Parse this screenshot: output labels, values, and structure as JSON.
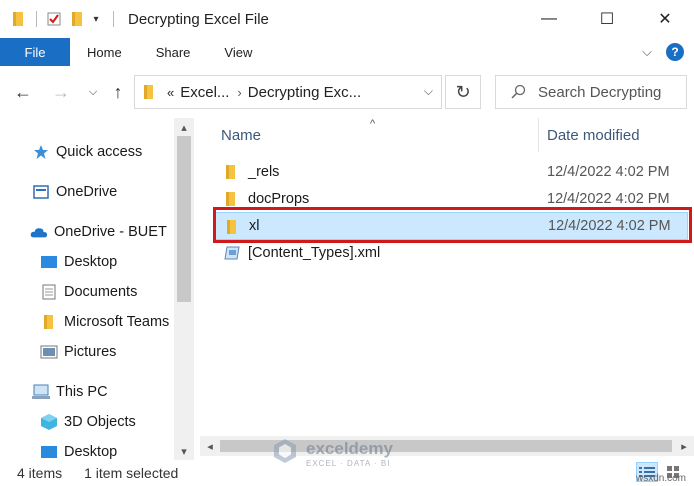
{
  "window": {
    "title": "Decrypting Excel File",
    "minimize": "—",
    "maximize": "☐",
    "close": "✕"
  },
  "ribbon": {
    "file": "File",
    "tabs": [
      "Home",
      "Share",
      "View"
    ]
  },
  "address": {
    "prefix": "«",
    "segments": [
      "Excel...",
      "Decrypting Exc..."
    ],
    "search_placeholder": "Search Decrypting"
  },
  "navpane": {
    "items": [
      {
        "label": "Quick access",
        "icon": "star-icon"
      },
      {
        "label": "OneDrive",
        "icon": "onedrive-icon"
      },
      {
        "label": "OneDrive - BUET",
        "icon": "cloud-icon"
      },
      {
        "label": "Desktop",
        "icon": "desktop-icon"
      },
      {
        "label": "Documents",
        "icon": "documents-icon"
      },
      {
        "label": "Microsoft Teams",
        "icon": "folder-icon"
      },
      {
        "label": "Pictures",
        "icon": "pictures-icon"
      },
      {
        "label": "This PC",
        "icon": "computer-icon"
      },
      {
        "label": "3D Objects",
        "icon": "3d-objects-icon"
      },
      {
        "label": "Desktop",
        "icon": "desktop-icon"
      }
    ]
  },
  "columns": {
    "name": "Name",
    "date": "Date modified"
  },
  "files": [
    {
      "name": "_rels",
      "date": "12/4/2022 4:02 PM",
      "type": "folder"
    },
    {
      "name": "docProps",
      "date": "12/4/2022 4:02 PM",
      "type": "folder"
    },
    {
      "name": "xl",
      "date": "12/4/2022 4:02 PM",
      "type": "folder",
      "selected": true
    },
    {
      "name": "[Content_Types].xml",
      "date": "",
      "type": "xml"
    }
  ],
  "status": {
    "count": "4 items",
    "selection": "1 item selected"
  },
  "watermark": {
    "name": "exceldemy",
    "tagline": "EXCEL · DATA · BI"
  },
  "credit": "wsxdn.com",
  "colors": {
    "accent": "#1a6fc4",
    "selection": "#cce8ff",
    "highlight_border": "#d0191a",
    "folder": "#f5c242"
  }
}
